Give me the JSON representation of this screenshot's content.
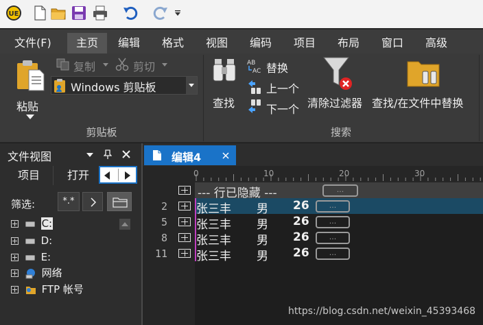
{
  "menu": {
    "items": [
      "文件(F)",
      "主页",
      "编辑",
      "格式",
      "视图",
      "编码",
      "项目",
      "布局",
      "窗口",
      "高级"
    ],
    "active_index": 1
  },
  "ribbon": {
    "clipboard": {
      "paste": "粘贴",
      "copy": "复制",
      "cut": "剪切",
      "clipboard_select": "Windows 剪贴板",
      "group": "剪贴板"
    },
    "search": {
      "find": "查找",
      "replace": "替换",
      "prev": "上一个",
      "next": "下一个",
      "clear_filter": "清除过滤器",
      "find_in_files": "查找/在文件中替换",
      "group": "搜索"
    }
  },
  "fileview": {
    "title": "文件视图",
    "tabs": [
      "项目",
      "打开"
    ],
    "filter_label": "筛选:",
    "filter_value": "*.*",
    "tree": [
      "C:",
      "D:",
      "E:",
      "网络",
      "FTP 帐号"
    ]
  },
  "editor": {
    "tab_label": "编辑4",
    "ruler": [
      "0",
      "10",
      "20",
      "30"
    ],
    "hidden_line_text": "--- 行已隐藏 ---",
    "ellipsis": "...",
    "lines": [
      {
        "no": "2",
        "name": "张三丰",
        "gender": "男",
        "age": "26"
      },
      {
        "no": "5",
        "name": "张三丰",
        "gender": "男",
        "age": "26"
      },
      {
        "no": "8",
        "name": "张三丰",
        "gender": "男",
        "age": "26"
      },
      {
        "no": "11",
        "name": "张三丰",
        "gender": "男",
        "age": "26"
      }
    ]
  },
  "watermark": "https://blog.csdn.net/weixin_45393468",
  "colors": {
    "accent": "#1a73c8",
    "selection": "#1b4a64",
    "ribbon_bg": "#3a3a3a",
    "editor_bg": "#1e1e1e"
  }
}
